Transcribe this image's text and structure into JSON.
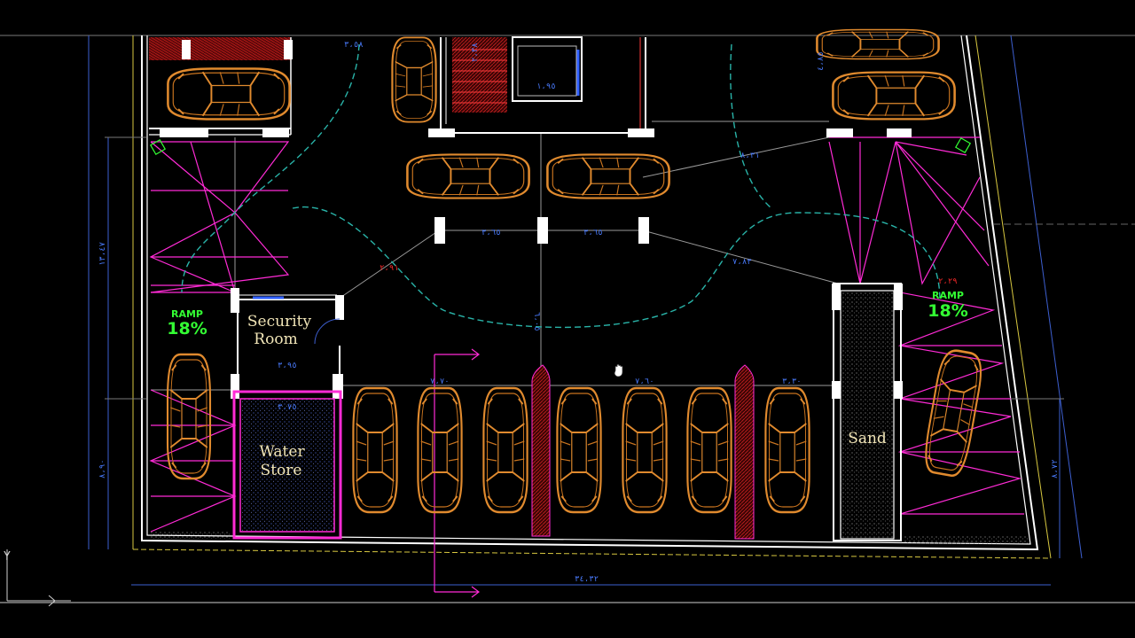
{
  "rooms": {
    "security": [
      "Security",
      "Room"
    ],
    "water": [
      "Water",
      "Store"
    ],
    "sand": "Sand"
  },
  "ramps": {
    "left": {
      "label": "RAMP",
      "grade": "18%"
    },
    "right": {
      "label": "RAMP",
      "grade": "18%"
    }
  },
  "dimensions": {
    "top_left": "٣،٥٨",
    "col_span_1": "٣،٦٥",
    "col_span_2": "٣،٦٥",
    "diag_right": "٨،٣١",
    "diag_right2": "٧،٨٣",
    "aisle": "٦،٠٥",
    "security_w": "٣،٩٥",
    "water_w": "٣،٧٥",
    "row_1": "٧،٧٠",
    "row_2": "٧،٦٠",
    "row_3": "٣،٣٠",
    "bottom_total": "٣٤،٣٢",
    "left_h": "١٣،٤٧",
    "left_h2": "٨،٩٠",
    "right_h": "٨،٧٢",
    "stair_1": "٢،٣٨",
    "stair_2": "١،٩٥",
    "top_right": "٤،٨٥",
    "red_mark": "٢،٩١",
    "red_mark2": "٢،٢٩"
  },
  "ucs": {
    "y_label": "Y"
  },
  "colors": {
    "background": "#000000",
    "wall": "#ffffff",
    "car": "#e08a2e",
    "magenta": "#ff2bd6",
    "cyan_path": "#29b3a8",
    "dimension": "#4a7cff",
    "ramp_text": "#33ff33",
    "room_text": "#f2e6b8",
    "sand_hatch": "#8a8a8a",
    "water_hatch": "#3d57c9"
  }
}
